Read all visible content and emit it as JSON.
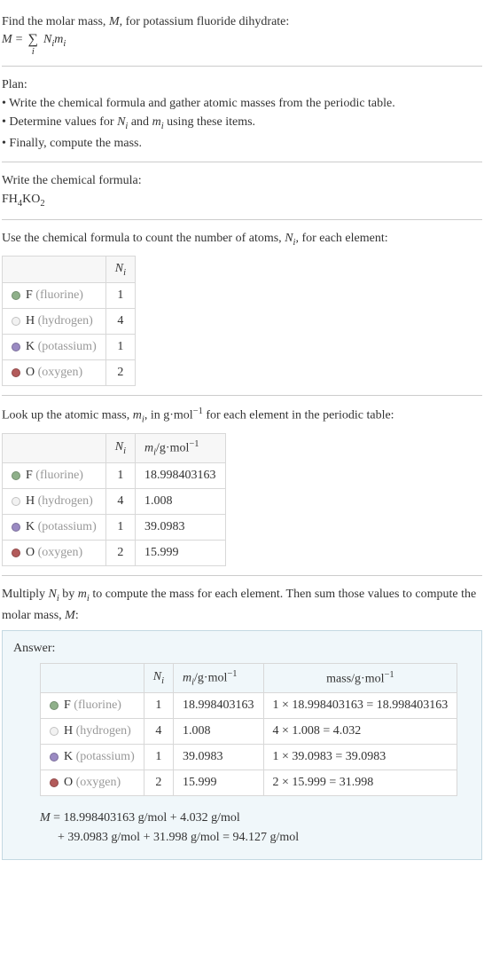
{
  "intro": {
    "title_prefix": "Find the molar mass, ",
    "title_var": "M",
    "title_suffix": ", for potassium fluoride dihydrate:",
    "eq_lhs": "M",
    "eq_eq": " = ",
    "sigma": "∑",
    "sigma_sub": "i",
    "eq_rhs_n": "N",
    "eq_rhs_n_sub": "i",
    "eq_rhs_m": "m",
    "eq_rhs_m_sub": "i"
  },
  "plan": {
    "heading": "Plan:",
    "b1_prefix": "• Write the chemical formula and gather atomic masses from the periodic table.",
    "b2_prefix": "• Determine values for ",
    "b2_n": "N",
    "b2_nsub": "i",
    "b2_mid": " and ",
    "b2_m": "m",
    "b2_msub": "i",
    "b2_suffix": " using these items.",
    "b3": "• Finally, compute the mass."
  },
  "formula_section": {
    "heading": "Write the chemical formula:",
    "f1": "FH",
    "f1_sub": "4",
    "f2": "KO",
    "f2_sub": "2"
  },
  "count_section": {
    "heading_prefix": "Use the chemical formula to count the number of atoms, ",
    "heading_var": "N",
    "heading_sub": "i",
    "heading_suffix": ", for each element:",
    "header_ni": "N",
    "header_ni_sub": "i",
    "rows": [
      {
        "dot": "f",
        "sym": "F",
        "name": "(fluorine)",
        "n": "1"
      },
      {
        "dot": "h",
        "sym": "H",
        "name": "(hydrogen)",
        "n": "4"
      },
      {
        "dot": "k",
        "sym": "K",
        "name": "(potassium)",
        "n": "1"
      },
      {
        "dot": "o",
        "sym": "O",
        "name": "(oxygen)",
        "n": "2"
      }
    ]
  },
  "mass_section": {
    "heading_prefix": "Look up the atomic mass, ",
    "heading_var": "m",
    "heading_sub": "i",
    "heading_mid": ", in g·mol",
    "heading_sup": "−1",
    "heading_suffix": " for each element in the periodic table:",
    "header_ni": "N",
    "header_ni_sub": "i",
    "header_mi": "m",
    "header_mi_sub": "i",
    "header_mi_unit": "/g·mol",
    "header_mi_sup": "−1",
    "rows": [
      {
        "dot": "f",
        "sym": "F",
        "name": "(fluorine)",
        "n": "1",
        "m": "18.998403163"
      },
      {
        "dot": "h",
        "sym": "H",
        "name": "(hydrogen)",
        "n": "4",
        "m": "1.008"
      },
      {
        "dot": "k",
        "sym": "K",
        "name": "(potassium)",
        "n": "1",
        "m": "39.0983"
      },
      {
        "dot": "o",
        "sym": "O",
        "name": "(oxygen)",
        "n": "2",
        "m": "15.999"
      }
    ]
  },
  "multiply_section": {
    "text_prefix": "Multiply ",
    "n": "N",
    "n_sub": "i",
    "mid": " by ",
    "m": "m",
    "m_sub": "i",
    "text_suffix": " to compute the mass for each element. Then sum those values to compute the molar mass, ",
    "mvar": "M",
    "tail": ":"
  },
  "answer": {
    "title": "Answer:",
    "header_ni": "N",
    "header_ni_sub": "i",
    "header_mi": "m",
    "header_mi_sub": "i",
    "header_mi_unit": "/g·mol",
    "header_mi_sup": "−1",
    "header_mass": "mass/g·mol",
    "header_mass_sup": "−1",
    "rows": [
      {
        "dot": "f",
        "sym": "F",
        "name": "(fluorine)",
        "n": "1",
        "m": "18.998403163",
        "mass": "1 × 18.998403163 = 18.998403163"
      },
      {
        "dot": "h",
        "sym": "H",
        "name": "(hydrogen)",
        "n": "4",
        "m": "1.008",
        "mass": "4 × 1.008 = 4.032"
      },
      {
        "dot": "k",
        "sym": "K",
        "name": "(potassium)",
        "n": "1",
        "m": "39.0983",
        "mass": "1 × 39.0983 = 39.0983"
      },
      {
        "dot": "o",
        "sym": "O",
        "name": "(oxygen)",
        "n": "2",
        "m": "15.999",
        "mass": "2 × 15.999 = 31.998"
      }
    ],
    "calc_line1_prefix": "M",
    "calc_line1": " = 18.998403163 g/mol + 4.032 g/mol",
    "calc_line2": "+ 39.0983 g/mol + 31.998 g/mol = 94.127 g/mol"
  }
}
